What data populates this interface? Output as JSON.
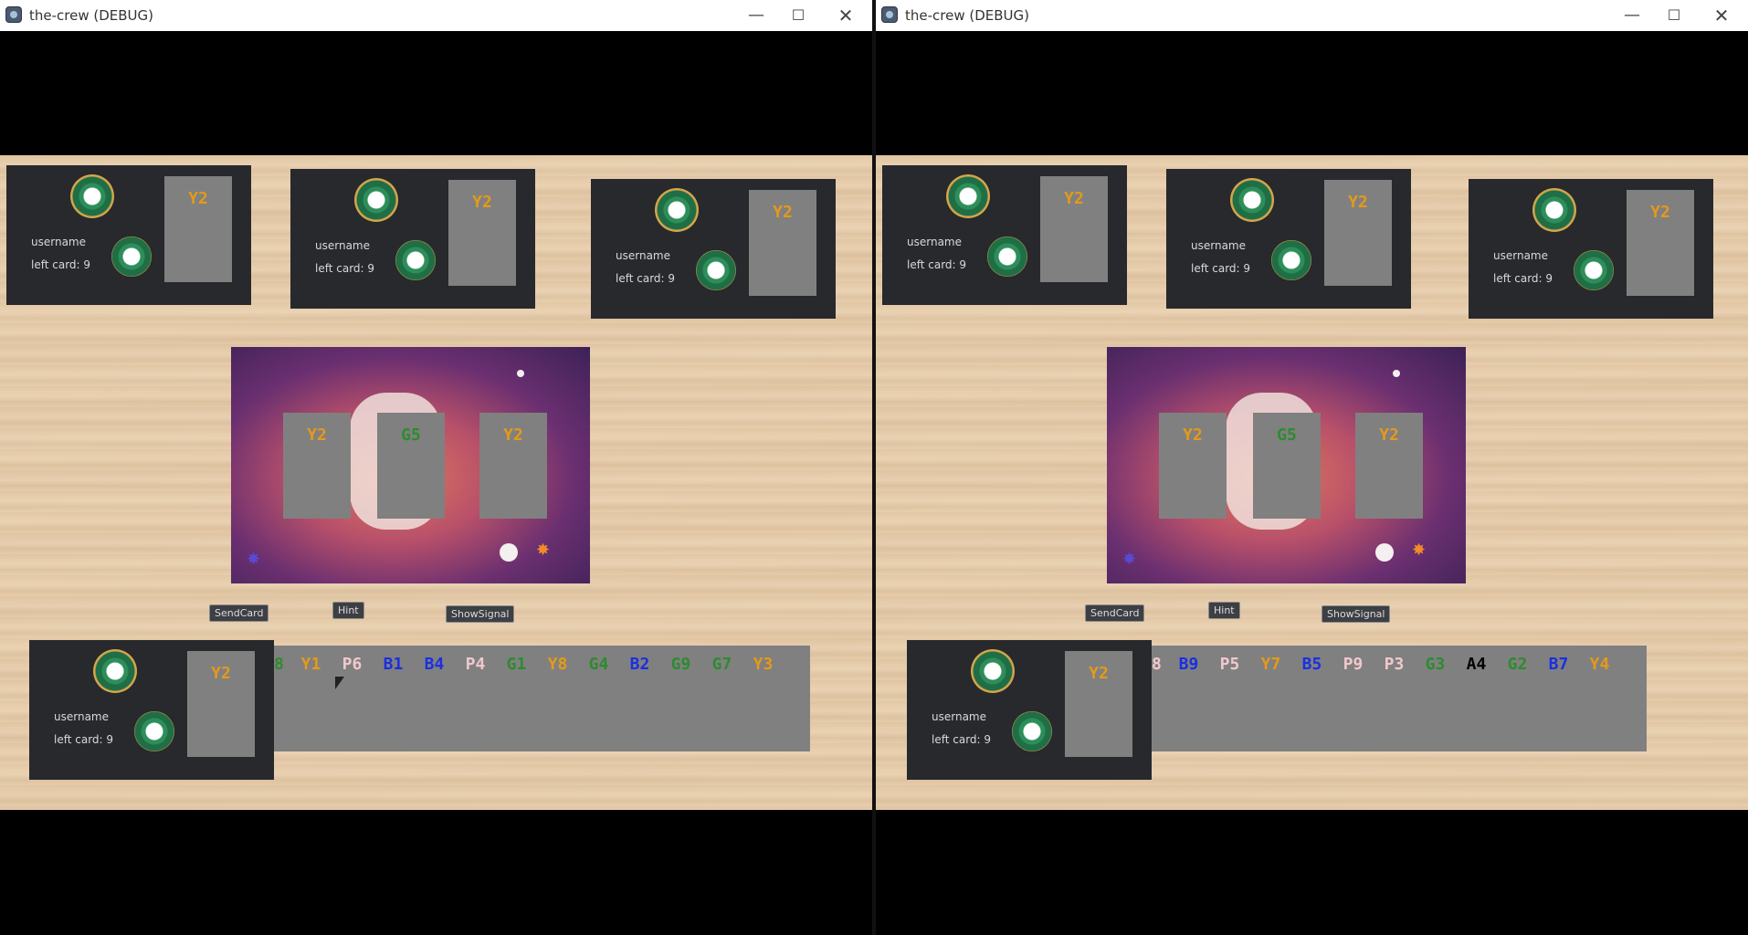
{
  "colors": {
    "yellow": "#e49a18",
    "green": "#2e8b2e",
    "blue": "#1a2fe0",
    "pink": "#f0c8cc",
    "black": "#000000"
  },
  "windows": [
    {
      "title": "the-crew (DEBUG)",
      "controls": {
        "minimize": "—",
        "maximize": "☐",
        "close": "✕"
      },
      "players": [
        {
          "username": "username",
          "left_card": "left card: 9",
          "card": "Y2"
        },
        {
          "username": "username",
          "left_card": "left card: 9",
          "card": "Y2"
        },
        {
          "username": "username",
          "left_card": "left card: 9",
          "card": "Y2"
        }
      ],
      "board_cards": [
        {
          "label": "Y2",
          "color": "yellow"
        },
        {
          "label": "G5",
          "color": "green"
        },
        {
          "label": "Y2",
          "color": "yellow"
        }
      ],
      "buttons": {
        "send_card": "SendCard",
        "hint": "Hint",
        "show_signal": "ShowSignal"
      },
      "self_player": {
        "username": "username",
        "left_card": "left card: 9",
        "card": "Y2"
      },
      "hand": [
        {
          "label": "8",
          "color": "green"
        },
        {
          "label": "Y1",
          "color": "yellow"
        },
        {
          "label": "P6",
          "color": "pink"
        },
        {
          "label": "B1",
          "color": "blue"
        },
        {
          "label": "B4",
          "color": "blue"
        },
        {
          "label": "P4",
          "color": "pink"
        },
        {
          "label": "G1",
          "color": "green"
        },
        {
          "label": "Y8",
          "color": "yellow"
        },
        {
          "label": "G4",
          "color": "green"
        },
        {
          "label": "B2",
          "color": "blue"
        },
        {
          "label": "G9",
          "color": "green"
        },
        {
          "label": "G7",
          "color": "green"
        },
        {
          "label": "Y3",
          "color": "yellow"
        }
      ]
    },
    {
      "title": "the-crew (DEBUG)",
      "controls": {
        "minimize": "—",
        "maximize": "☐",
        "close": "✕"
      },
      "players": [
        {
          "username": "username",
          "left_card": "left card: 9",
          "card": "Y2"
        },
        {
          "username": "username",
          "left_card": "left card: 9",
          "card": "Y2"
        },
        {
          "username": "username",
          "left_card": "left card: 9",
          "card": "Y2"
        }
      ],
      "board_cards": [
        {
          "label": "Y2",
          "color": "yellow"
        },
        {
          "label": "G5",
          "color": "green"
        },
        {
          "label": "Y2",
          "color": "yellow"
        }
      ],
      "buttons": {
        "send_card": "SendCard",
        "hint": "Hint",
        "show_signal": "ShowSignal"
      },
      "self_player": {
        "username": "username",
        "left_card": "left card: 9",
        "card": "Y2"
      },
      "hand": [
        {
          "label": "8",
          "color": "pink"
        },
        {
          "label": "B9",
          "color": "blue"
        },
        {
          "label": "P5",
          "color": "pink"
        },
        {
          "label": "Y7",
          "color": "yellow"
        },
        {
          "label": "B5",
          "color": "blue"
        },
        {
          "label": "P9",
          "color": "pink"
        },
        {
          "label": "P3",
          "color": "pink"
        },
        {
          "label": "G3",
          "color": "green"
        },
        {
          "label": "A4",
          "color": "black"
        },
        {
          "label": "G2",
          "color": "green"
        },
        {
          "label": "B7",
          "color": "blue"
        },
        {
          "label": "Y4",
          "color": "yellow"
        }
      ]
    }
  ]
}
